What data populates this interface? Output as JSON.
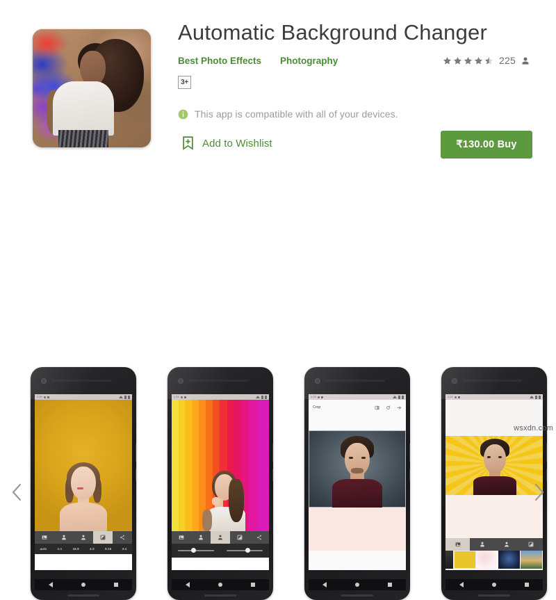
{
  "app": {
    "title": "Automatic Background Changer",
    "developer": "Best Photo Effects",
    "category": "Photography",
    "age_rating": "3+",
    "rating_value": 4.5,
    "rating_count": "225",
    "compatibility": "This app is compatible with all of your devices.",
    "wishlist_label": "Add to Wishlist",
    "buy_label": "₹130.00 Buy",
    "icon_alt": "woman-with-curly-hair-colored-smoke-background"
  },
  "colors": {
    "accent_green": "#4c8b37",
    "buy_green": "#5d9a3f",
    "title_gray": "#3c3c3c",
    "muted_gray": "#9b9b9b",
    "star_gray": "#7b7b7b"
  },
  "carousel": {
    "prev_label": "‹",
    "next_label": "›",
    "screenshots": [
      {
        "name": "screenshot-yellow-background-crop",
        "status_time": "1:30",
        "background": "#d9a41b",
        "subject": "woman-portrait",
        "toolbar_icons": [
          "image-icon",
          "person-cutout-icon",
          "person-fill-icon",
          "adjust-icon",
          "share-icon"
        ],
        "active_tool_index": 3,
        "ratios": [
          "auto",
          "1:1",
          "16:9",
          "4:3",
          "9:16",
          "3:4"
        ]
      },
      {
        "name": "screenshot-rainbow-background-sliders",
        "status_time": "1:34",
        "background": "rainbow-stripes",
        "subject": "woman-profile",
        "toolbar_icons": [
          "image-icon",
          "person-cutout-icon",
          "person-fill-icon",
          "adjust-icon",
          "share-icon"
        ],
        "active_tool_index": 2,
        "slider_values": [
          36,
          52
        ]
      },
      {
        "name": "screenshot-crop-screen",
        "status_time": "1:29",
        "appbar_title": "Crop",
        "appbar_icons": [
          "flip-icon",
          "rotate-icon",
          "next-arrow-icon"
        ],
        "subject": "man-portrait"
      },
      {
        "name": "screenshot-yellow-sunburst-backgrounds",
        "status_time": "1:30",
        "background": "yellow-sunburst",
        "subject": "man-portrait",
        "toolbar_icons": [
          "image-icon",
          "person-cutout-icon",
          "person-fill-icon",
          "adjust-icon"
        ],
        "active_tool_index": 0,
        "thumbnails": [
          "#e8c52a",
          "#f6dfe3",
          "#1b2a4a",
          "#4c7a4f"
        ]
      }
    ]
  },
  "watermark": "wsxdn.com"
}
